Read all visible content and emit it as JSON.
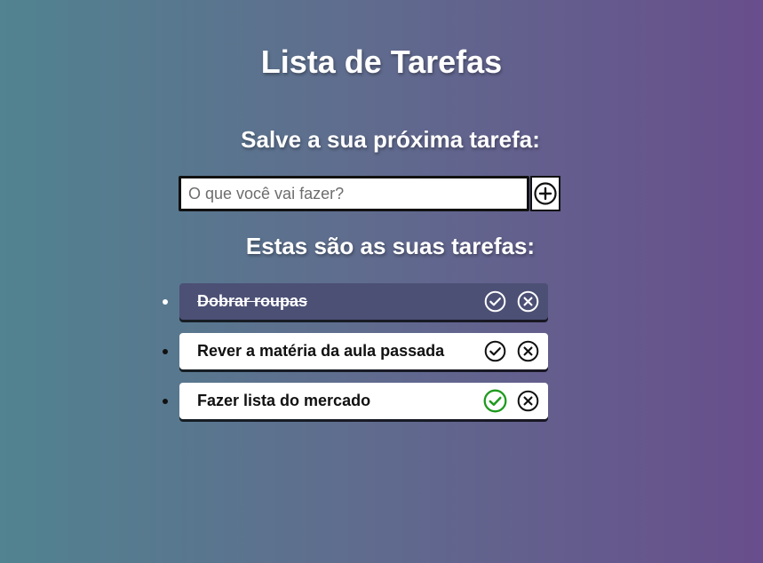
{
  "header": {
    "title": "Lista de Tarefas"
  },
  "form": {
    "heading": "Salve a sua próxima tarefa:",
    "input_placeholder": "O que você vai fazer?",
    "input_value": "",
    "add_button_icon": "plus-circle-icon"
  },
  "tasks_section": {
    "heading": "Estas são as suas tarefas:",
    "items": [
      {
        "text": "Dobrar roupas",
        "completed": true,
        "check_icon": "check-circle-icon",
        "remove_icon": "x-circle-icon"
      },
      {
        "text": "Rever a matéria da aula passada",
        "completed": false,
        "check_icon": "check-circle-icon",
        "remove_icon": "x-circle-icon"
      },
      {
        "text": "Fazer lista do mercado",
        "completed": false,
        "check_icon": "check-circle-icon",
        "remove_icon": "x-circle-icon",
        "check_highlighted": true
      }
    ]
  },
  "colors": {
    "gradient_left": "#518390",
    "gradient_right": "#684e8c",
    "done_item_bg": "#4c5075",
    "check_hover": "#1e9a1e"
  }
}
